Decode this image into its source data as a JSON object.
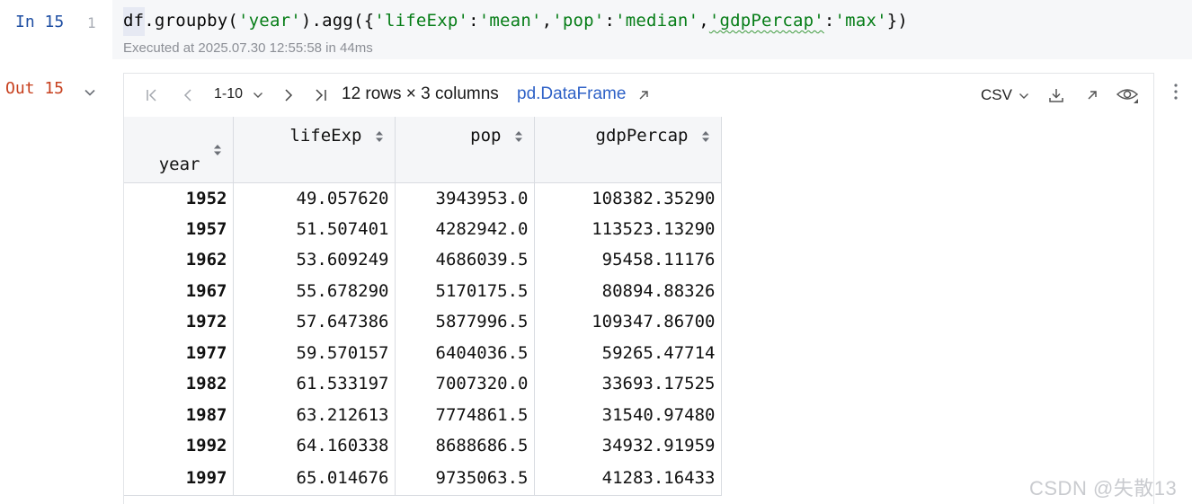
{
  "input_cell": {
    "prompt": "In 15",
    "line_number": "1",
    "code_tokens": [
      {
        "t": "df.groupby(",
        "k": "plain"
      },
      {
        "t": "'year'",
        "k": "str"
      },
      {
        "t": ").agg({",
        "k": "plain"
      },
      {
        "t": "'lifeExp'",
        "k": "str"
      },
      {
        "t": ":",
        "k": "plain"
      },
      {
        "t": "'mean'",
        "k": "str"
      },
      {
        "t": ",",
        "k": "plain"
      },
      {
        "t": "'pop'",
        "k": "str"
      },
      {
        "t": ":",
        "k": "plain"
      },
      {
        "t": "'median'",
        "k": "str"
      },
      {
        "t": ",",
        "k": "plain"
      },
      {
        "t": "'gdpPercap'",
        "k": "str",
        "wavy": true
      },
      {
        "t": ":",
        "k": "plain"
      },
      {
        "t": "'max'",
        "k": "str"
      },
      {
        "t": "})",
        "k": "plain"
      }
    ],
    "exec_info": "Executed at 2025.07.30 12:55:58 in 44ms"
  },
  "output_cell": {
    "prompt": "Out 15",
    "toolbar": {
      "page_range": "1-10",
      "rows_info": "12 rows × 3 columns",
      "df_link": "pd.DataFrame",
      "export_format": "CSV"
    },
    "table": {
      "index_header": "year",
      "columns": [
        "lifeExp",
        "pop",
        "gdpPercap"
      ],
      "rows": [
        [
          "1952",
          "49.057620",
          "3943953.0",
          "108382.35290"
        ],
        [
          "1957",
          "51.507401",
          "4282942.0",
          "113523.13290"
        ],
        [
          "1962",
          "53.609249",
          "4686039.5",
          "95458.11176"
        ],
        [
          "1967",
          "55.678290",
          "5170175.5",
          "80894.88326"
        ],
        [
          "1972",
          "57.647386",
          "5877996.5",
          "109347.86700"
        ],
        [
          "1977",
          "59.570157",
          "6404036.5",
          "59265.47714"
        ],
        [
          "1982",
          "61.533197",
          "7007320.0",
          "33693.17525"
        ],
        [
          "1987",
          "63.212613",
          "7774861.5",
          "31540.97480"
        ],
        [
          "1992",
          "64.160338",
          "8688686.5",
          "34932.91959"
        ],
        [
          "1997",
          "65.014676",
          "9735063.5",
          "41283.16433"
        ]
      ]
    }
  },
  "watermark": "CSDN @失散13",
  "colors": {
    "string": "#067d17",
    "in_prompt": "#1f4fa3",
    "out_prompt": "#c7401e",
    "link": "#2f62c7"
  }
}
